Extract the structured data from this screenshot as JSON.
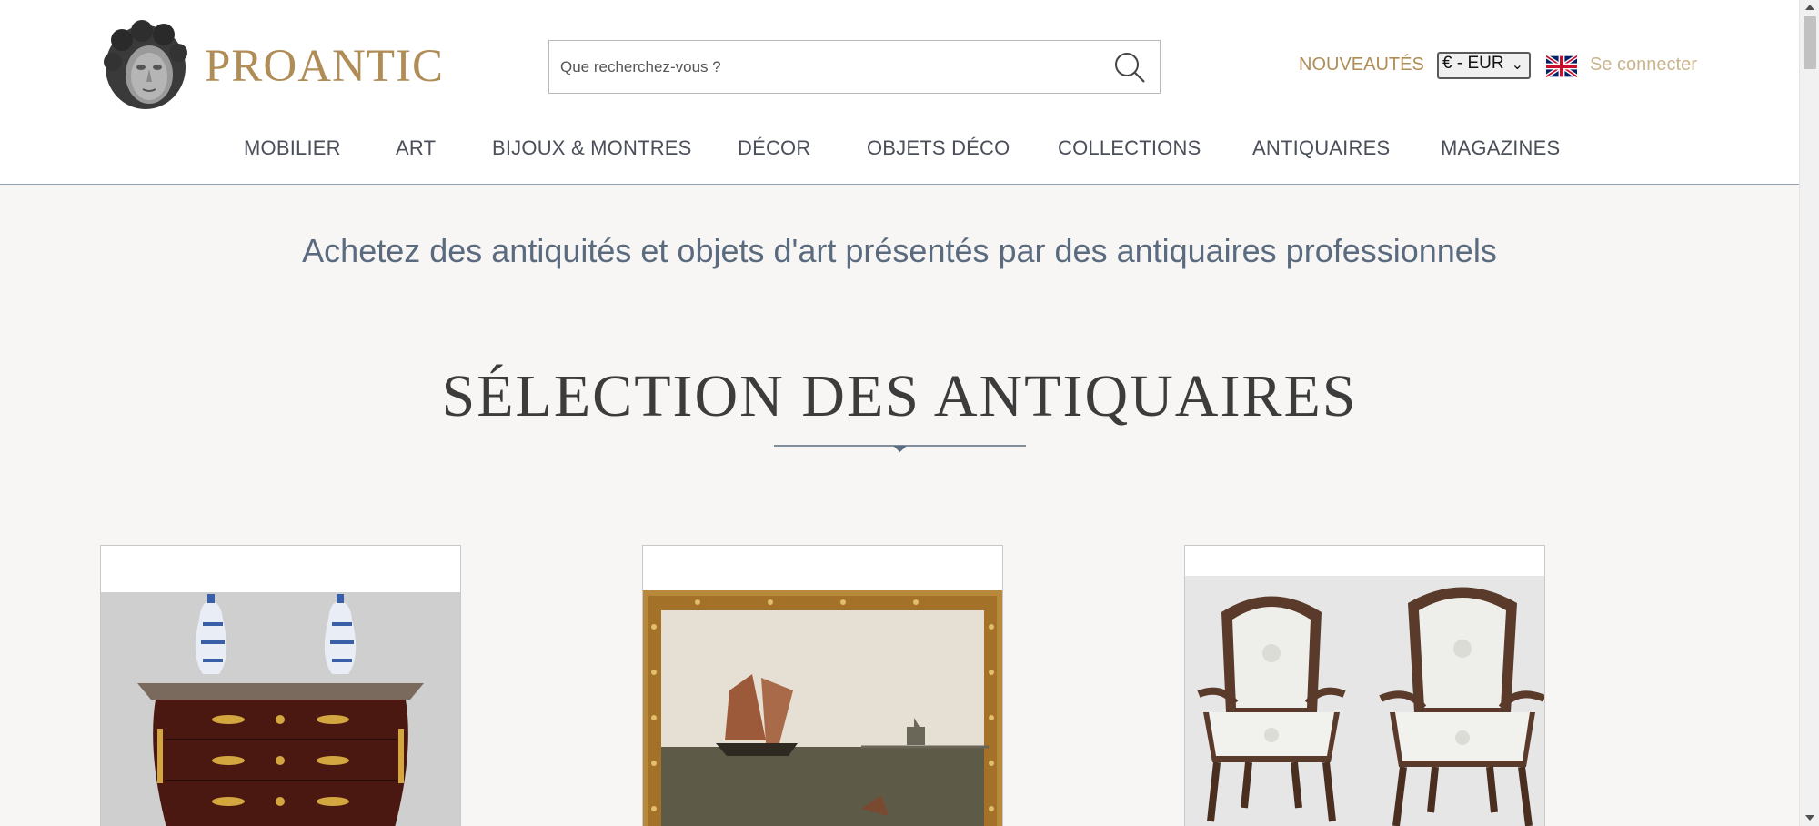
{
  "header": {
    "logo_text": "PROANTIC",
    "search": {
      "placeholder": "Que recherchez-vous ?",
      "value": ""
    },
    "nouveautes_label": "NOUVEAUTÉS",
    "currency_selected": "€ - EUR",
    "language_flag": "uk-flag-icon",
    "signin_label": "Se connecter"
  },
  "nav": {
    "items": [
      {
        "label": "MOBILIER"
      },
      {
        "label": "ART"
      },
      {
        "label": "BIJOUX & MONTRES"
      },
      {
        "label": "DÉCOR"
      },
      {
        "label": "OBJETS DÉCO"
      },
      {
        "label": "COLLECTIONS"
      },
      {
        "label": "ANTIQUAIRES"
      },
      {
        "label": "MAGAZINES"
      }
    ]
  },
  "main": {
    "tagline": "Achetez des antiquités et objets d'art présentés par des antiquaires professionnels",
    "section_title": "SÉLECTION DES ANTIQUAIRES",
    "cards": [
      {
        "image": "commode-with-delft-vases-image"
      },
      {
        "image": "framed-marine-painting-image"
      },
      {
        "image": "pair-of-louis-xv-armchairs-image"
      }
    ]
  },
  "colors": {
    "brand_gold": "#b08d57",
    "signin_gold": "#c9b48d",
    "tagline_blue": "#5a6b80",
    "nav_text": "#4a4f5a",
    "page_bg": "#f7f6f4"
  }
}
